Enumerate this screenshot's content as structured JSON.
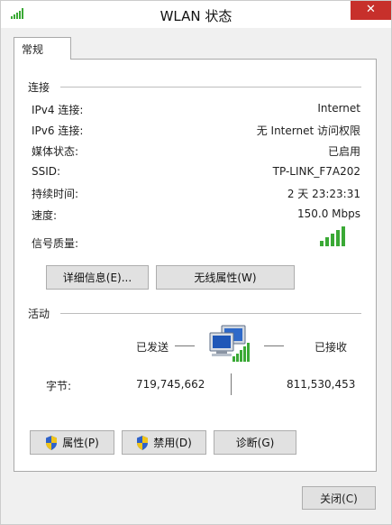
{
  "window": {
    "title": "WLAN 状态"
  },
  "tabs": [
    {
      "label": "常规"
    }
  ],
  "connection": {
    "section_label": "连接",
    "rows": [
      {
        "label": "IPv4 连接:",
        "value": "Internet"
      },
      {
        "label": "IPv6 连接:",
        "value": "无 Internet 访问权限"
      },
      {
        "label": "媒体状态:",
        "value": "已启用"
      },
      {
        "label": "SSID:",
        "value": "TP-LINK_F7A202"
      },
      {
        "label": "持续时间:",
        "value": "2 天 23:23:31"
      },
      {
        "label": "速度:",
        "value": "150.0 Mbps"
      }
    ],
    "signal_label": "信号质量:",
    "signal_bars": 5,
    "signal_bars_max": 5,
    "details_button": "详细信息(E)...",
    "wireless_button": "无线属性(W)"
  },
  "activity": {
    "section_label": "活动",
    "sent_label": "已发送",
    "received_label": "已接收",
    "bytes_label": "字节:",
    "bytes_sent": "719,745,662",
    "bytes_received": "811,530,453"
  },
  "buttons": {
    "properties": "属性(P)",
    "disable": "禁用(D)",
    "diagnose": "诊断(G)",
    "close": "关闭(C)"
  },
  "colors": {
    "close_button": "#c7302b",
    "signal": "#3aa935"
  },
  "icons": [
    "wifi-signal-icon",
    "close-icon",
    "uac-shield-icon",
    "network-computers-icon",
    "signal-strength-icon"
  ]
}
